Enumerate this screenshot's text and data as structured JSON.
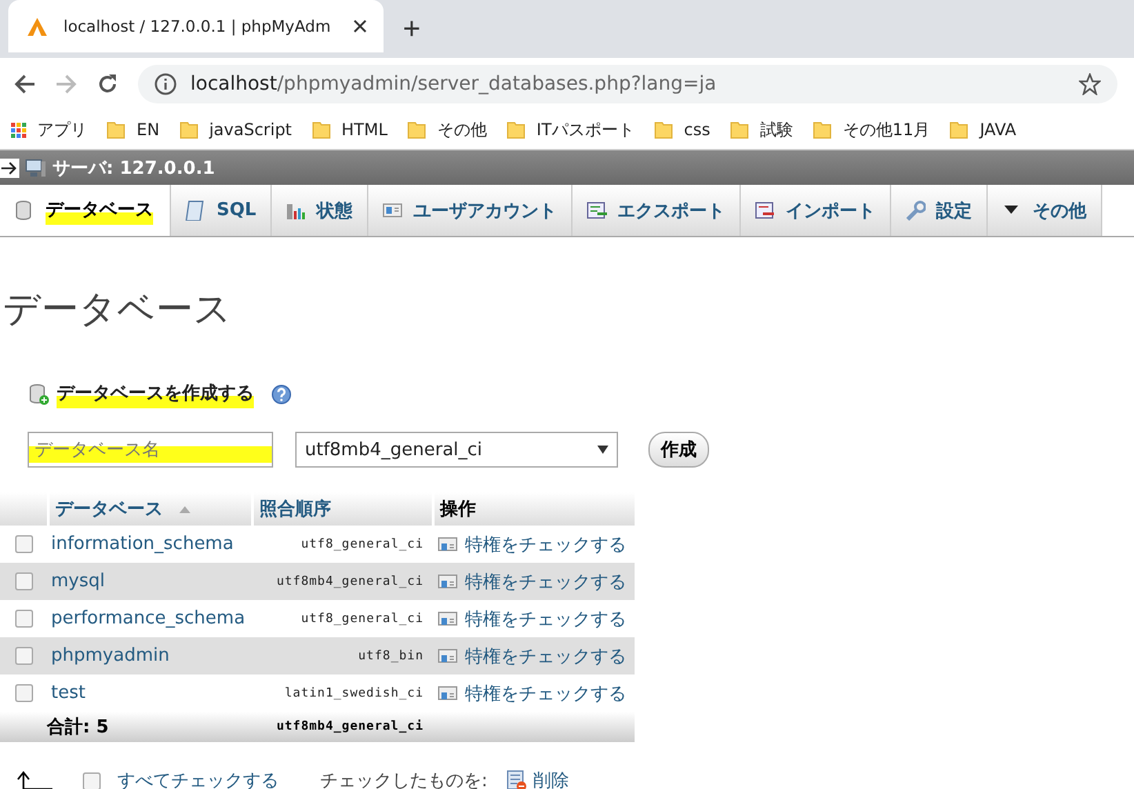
{
  "browser": {
    "tab_title": "localhost / 127.0.0.1 | phpMyAdm",
    "new_tab": "+",
    "address": {
      "host": "localhost",
      "path": "/phpmyadmin/server_databases.php?lang=ja"
    },
    "bookmarks": [
      {
        "label": "アプリ",
        "kind": "apps"
      },
      {
        "label": "EN",
        "kind": "folder"
      },
      {
        "label": "javaScript",
        "kind": "folder"
      },
      {
        "label": "HTML",
        "kind": "folder"
      },
      {
        "label": "その他",
        "kind": "folder"
      },
      {
        "label": "ITパスポート",
        "kind": "folder"
      },
      {
        "label": "css",
        "kind": "folder"
      },
      {
        "label": "試験",
        "kind": "folder"
      },
      {
        "label": "その他11月",
        "kind": "folder"
      },
      {
        "label": "JAVA",
        "kind": "folder"
      }
    ]
  },
  "server_bar": {
    "title": "サーバ: 127.0.0.1"
  },
  "tabs": [
    {
      "label": "データベース",
      "kind": "db",
      "selected": true,
      "highlighted": true
    },
    {
      "label": "SQL",
      "kind": "sql",
      "selected": false,
      "highlighted": false
    },
    {
      "label": "状態",
      "kind": "status",
      "selected": false,
      "highlighted": false
    },
    {
      "label": "ユーザアカウント",
      "kind": "user",
      "selected": false,
      "highlighted": false
    },
    {
      "label": "エクスポート",
      "kind": "export",
      "selected": false,
      "highlighted": false
    },
    {
      "label": "インポート",
      "kind": "import",
      "selected": false,
      "highlighted": false
    },
    {
      "label": "設定",
      "kind": "settings",
      "selected": false,
      "highlighted": false
    },
    {
      "label": "その他",
      "kind": "more",
      "selected": false,
      "highlighted": false
    }
  ],
  "page_title": "データベース",
  "create": {
    "heading": "データベースを作成する",
    "highlighted": true,
    "name_field": {
      "placeholder": "データベース名",
      "highlighted": true
    },
    "collation": "utf8mb4_general_ci",
    "button": "作成"
  },
  "table": {
    "columns": [
      "データベース",
      "照合順序",
      "操作"
    ],
    "rows": [
      {
        "name": "information_schema",
        "collation": "utf8_general_ci",
        "action": "特権をチェックする",
        "checked": false
      },
      {
        "name": "mysql",
        "collation": "utf8mb4_general_ci",
        "action": "特権をチェックする",
        "checked": false
      },
      {
        "name": "performance_schema",
        "collation": "utf8_general_ci",
        "action": "特権をチェックする",
        "checked": false
      },
      {
        "name": "phpmyadmin",
        "collation": "utf8_bin",
        "action": "特権をチェックする",
        "checked": false
      },
      {
        "name": "test",
        "collation": "latin1_swedish_ci",
        "action": "特権をチェックする",
        "checked": false
      }
    ],
    "total": {
      "label": "合計: 5",
      "collation": "utf8mb4_general_ci"
    }
  },
  "footer": {
    "check_all": {
      "label": "すべてチェックする",
      "checked": false
    },
    "with_selected": "チェックしたものを:",
    "delete": "削除"
  }
}
